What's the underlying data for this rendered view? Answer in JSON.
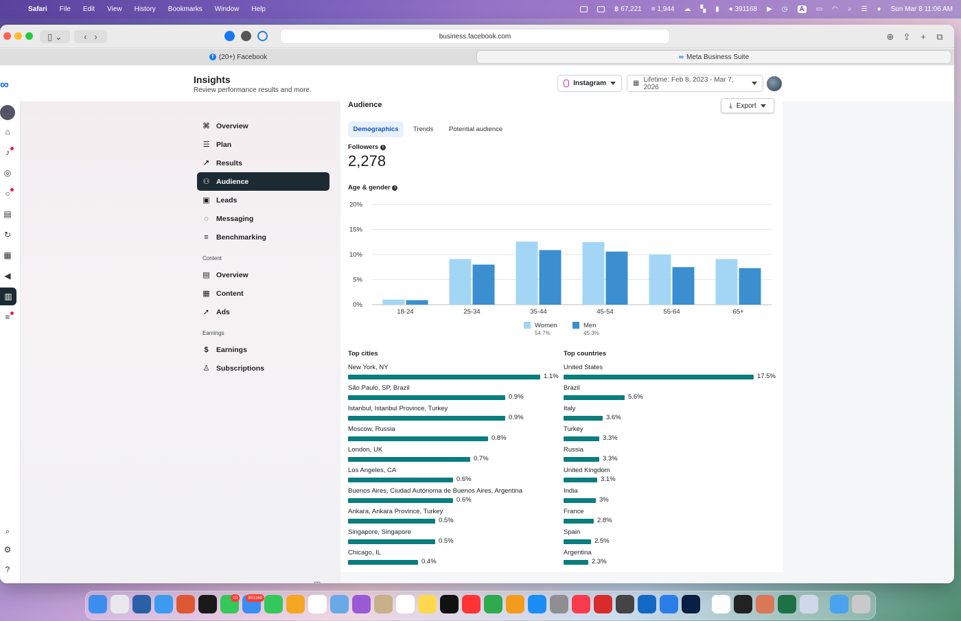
{
  "menubar": {
    "app": "Safari",
    "items": [
      "File",
      "Edit",
      "View",
      "History",
      "Bookmarks",
      "Window",
      "Help"
    ],
    "status": {
      "stat1": "67,221",
      "stat2": "1,944",
      "mail_count": "391168",
      "datetime": "Sun Mar 8  11:06 AM"
    }
  },
  "browser": {
    "url": "business.facebook.com",
    "tabs": [
      {
        "label": "(20+) Facebook"
      },
      {
        "label": "Meta Business Suite"
      }
    ]
  },
  "header": {
    "title": "Insights",
    "subtitle": "Review performance results and more.",
    "platform": "Instagram",
    "date_range": "Lifetime: Feb 8, 2023 - Mar 7, 2026"
  },
  "nav": {
    "items": [
      {
        "label": "Overview",
        "icon": "overview-icon"
      },
      {
        "label": "Plan",
        "icon": "list-icon"
      },
      {
        "label": "Results",
        "icon": "results-icon"
      },
      {
        "label": "Audience",
        "icon": "people-icon",
        "selected": true
      },
      {
        "label": "Leads",
        "icon": "leads-icon"
      },
      {
        "label": "Messaging",
        "icon": "messaging-icon"
      },
      {
        "label": "Benchmarking",
        "icon": "benchmark-icon"
      }
    ],
    "content_section": "Content",
    "content_items": [
      {
        "label": "Overview",
        "icon": "content-overview-icon"
      },
      {
        "label": "Content",
        "icon": "grid-icon"
      },
      {
        "label": "Ads",
        "icon": "rocket-icon"
      }
    ],
    "earnings_section": "Earnings",
    "earnings_items": [
      {
        "label": "Earnings",
        "icon": "dollar-icon"
      },
      {
        "label": "Subscriptions",
        "icon": "person-icon"
      }
    ]
  },
  "audience": {
    "title": "Audience",
    "export_label": "Export",
    "tabs": [
      "Demographics",
      "Trends",
      "Potential audience"
    ],
    "followers_label": "Followers",
    "followers_value": "2,278",
    "age_gender_label": "Age & gender"
  },
  "chart_data": {
    "type": "bar",
    "categories": [
      "18-24",
      "25-34",
      "35-44",
      "45-54",
      "55-64",
      "65+"
    ],
    "series": [
      {
        "name": "Women",
        "values": [
          1.0,
          9.1,
          12.6,
          12.5,
          10.0,
          9.1
        ],
        "share": "54.7%",
        "color": "#a3d6f5"
      },
      {
        "name": "Men",
        "values": [
          0.9,
          8.0,
          10.9,
          10.6,
          7.5,
          7.3
        ],
        "share": "45.3%",
        "color": "#3b8fd0"
      }
    ],
    "yticks": [
      "0%",
      "5%",
      "10%",
      "15%",
      "20%"
    ],
    "ylim": [
      0,
      20
    ],
    "grid": true,
    "legend": "bottom"
  },
  "top_cities": {
    "title": "Top cities",
    "items": [
      {
        "name": "New York, NY",
        "value": 1.1,
        "label": "1.1%"
      },
      {
        "name": "São Paulo, SP, Brazil",
        "value": 0.9,
        "label": "0.9%"
      },
      {
        "name": "Istanbul, Istanbul Province, Turkey",
        "value": 0.9,
        "label": "0.9%"
      },
      {
        "name": "Moscow, Russia",
        "value": 0.8,
        "label": "0.8%"
      },
      {
        "name": "London, UK",
        "value": 0.7,
        "label": "0.7%"
      },
      {
        "name": "Los Angeles, CA",
        "value": 0.6,
        "label": "0.6%"
      },
      {
        "name": "Buenos Aires, Ciudad Autónoma de Buenos Aires, Argentina",
        "value": 0.6,
        "label": "0.6%"
      },
      {
        "name": "Ankara, Ankara Province, Turkey",
        "value": 0.5,
        "label": "0.5%"
      },
      {
        "name": "Singapore, Singapore",
        "value": 0.5,
        "label": "0.5%"
      },
      {
        "name": "Chicago, IL",
        "value": 0.4,
        "label": "0.4%"
      }
    ]
  },
  "top_countries": {
    "title": "Top countries",
    "items": [
      {
        "name": "United States",
        "value": 17.5,
        "label": "17.5%"
      },
      {
        "name": "Brazil",
        "value": 5.6,
        "label": "5.6%"
      },
      {
        "name": "Italy",
        "value": 3.6,
        "label": "3.6%"
      },
      {
        "name": "Turkey",
        "value": 3.3,
        "label": "3.3%"
      },
      {
        "name": "Russia",
        "value": 3.3,
        "label": "3.3%"
      },
      {
        "name": "United Kingdom",
        "value": 3.1,
        "label": "3.1%"
      },
      {
        "name": "India",
        "value": 3,
        "label": "3%"
      },
      {
        "name": "France",
        "value": 2.8,
        "label": "2.8%"
      },
      {
        "name": "Spain",
        "value": 2.5,
        "label": "2.5%"
      },
      {
        "name": "Argentina",
        "value": 2.3,
        "label": "2.3%"
      }
    ]
  },
  "dock": {
    "badges": {
      "messages": "10",
      "mail": "391168"
    }
  }
}
